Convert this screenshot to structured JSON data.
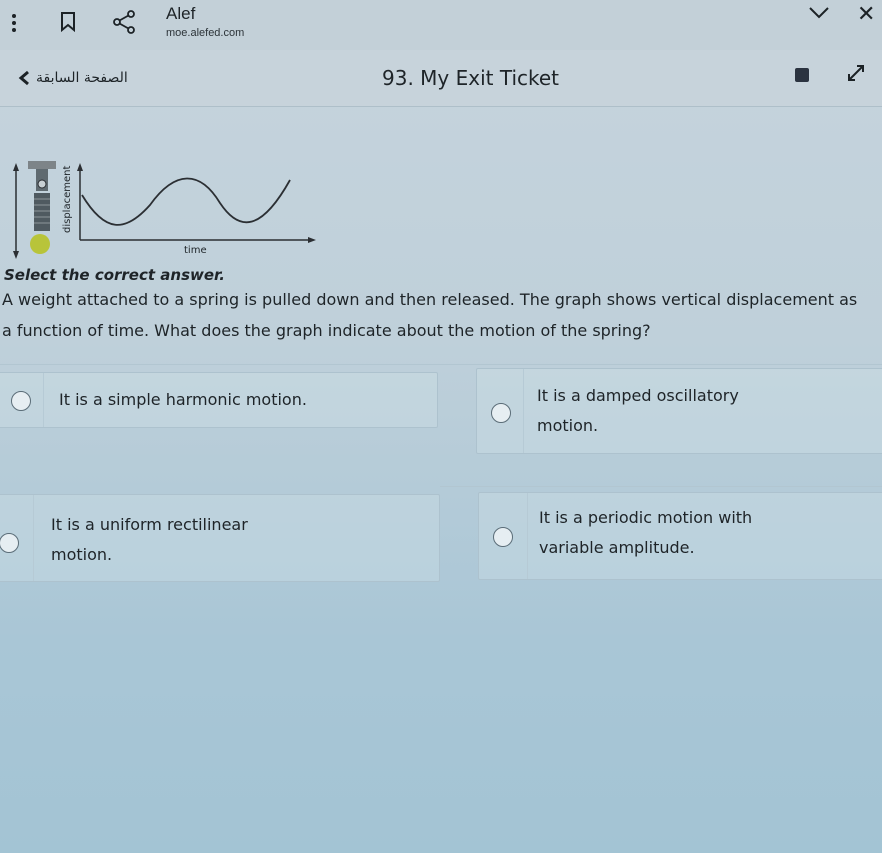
{
  "app": {
    "title": "Alef",
    "url": "moe.alefed.com"
  },
  "icons": {
    "menu": "kebab-menu-icon",
    "bookmark": "bookmark-icon",
    "share": "share-icon",
    "collapse": "chevron-down-icon",
    "close": "close-icon",
    "back": "chevron-left-icon",
    "tool": "tool-icon",
    "expand": "expand-icon"
  },
  "nav": {
    "prev_label": "الصفحة السابقة",
    "page_title": "93. My Exit Ticket"
  },
  "figure": {
    "y_axis_label": "displacement",
    "x_axis_label": "time"
  },
  "question": {
    "instruction": "Select the correct answer.",
    "text": "A weight attached to a spring is pulled down and then released. The graph shows vertical displacement as a function of time. What does the graph indicate about the motion of the spring?"
  },
  "options": [
    {
      "text": "It is a simple harmonic motion."
    },
    {
      "text": "It is a damped oscillatory motion."
    },
    {
      "text": "It is a uniform rectilinear motion."
    },
    {
      "text": "It is a periodic motion with variable amplitude."
    }
  ],
  "colors": {
    "accent_dark": "#1e2428",
    "spring_ball": "#b8c43a"
  }
}
